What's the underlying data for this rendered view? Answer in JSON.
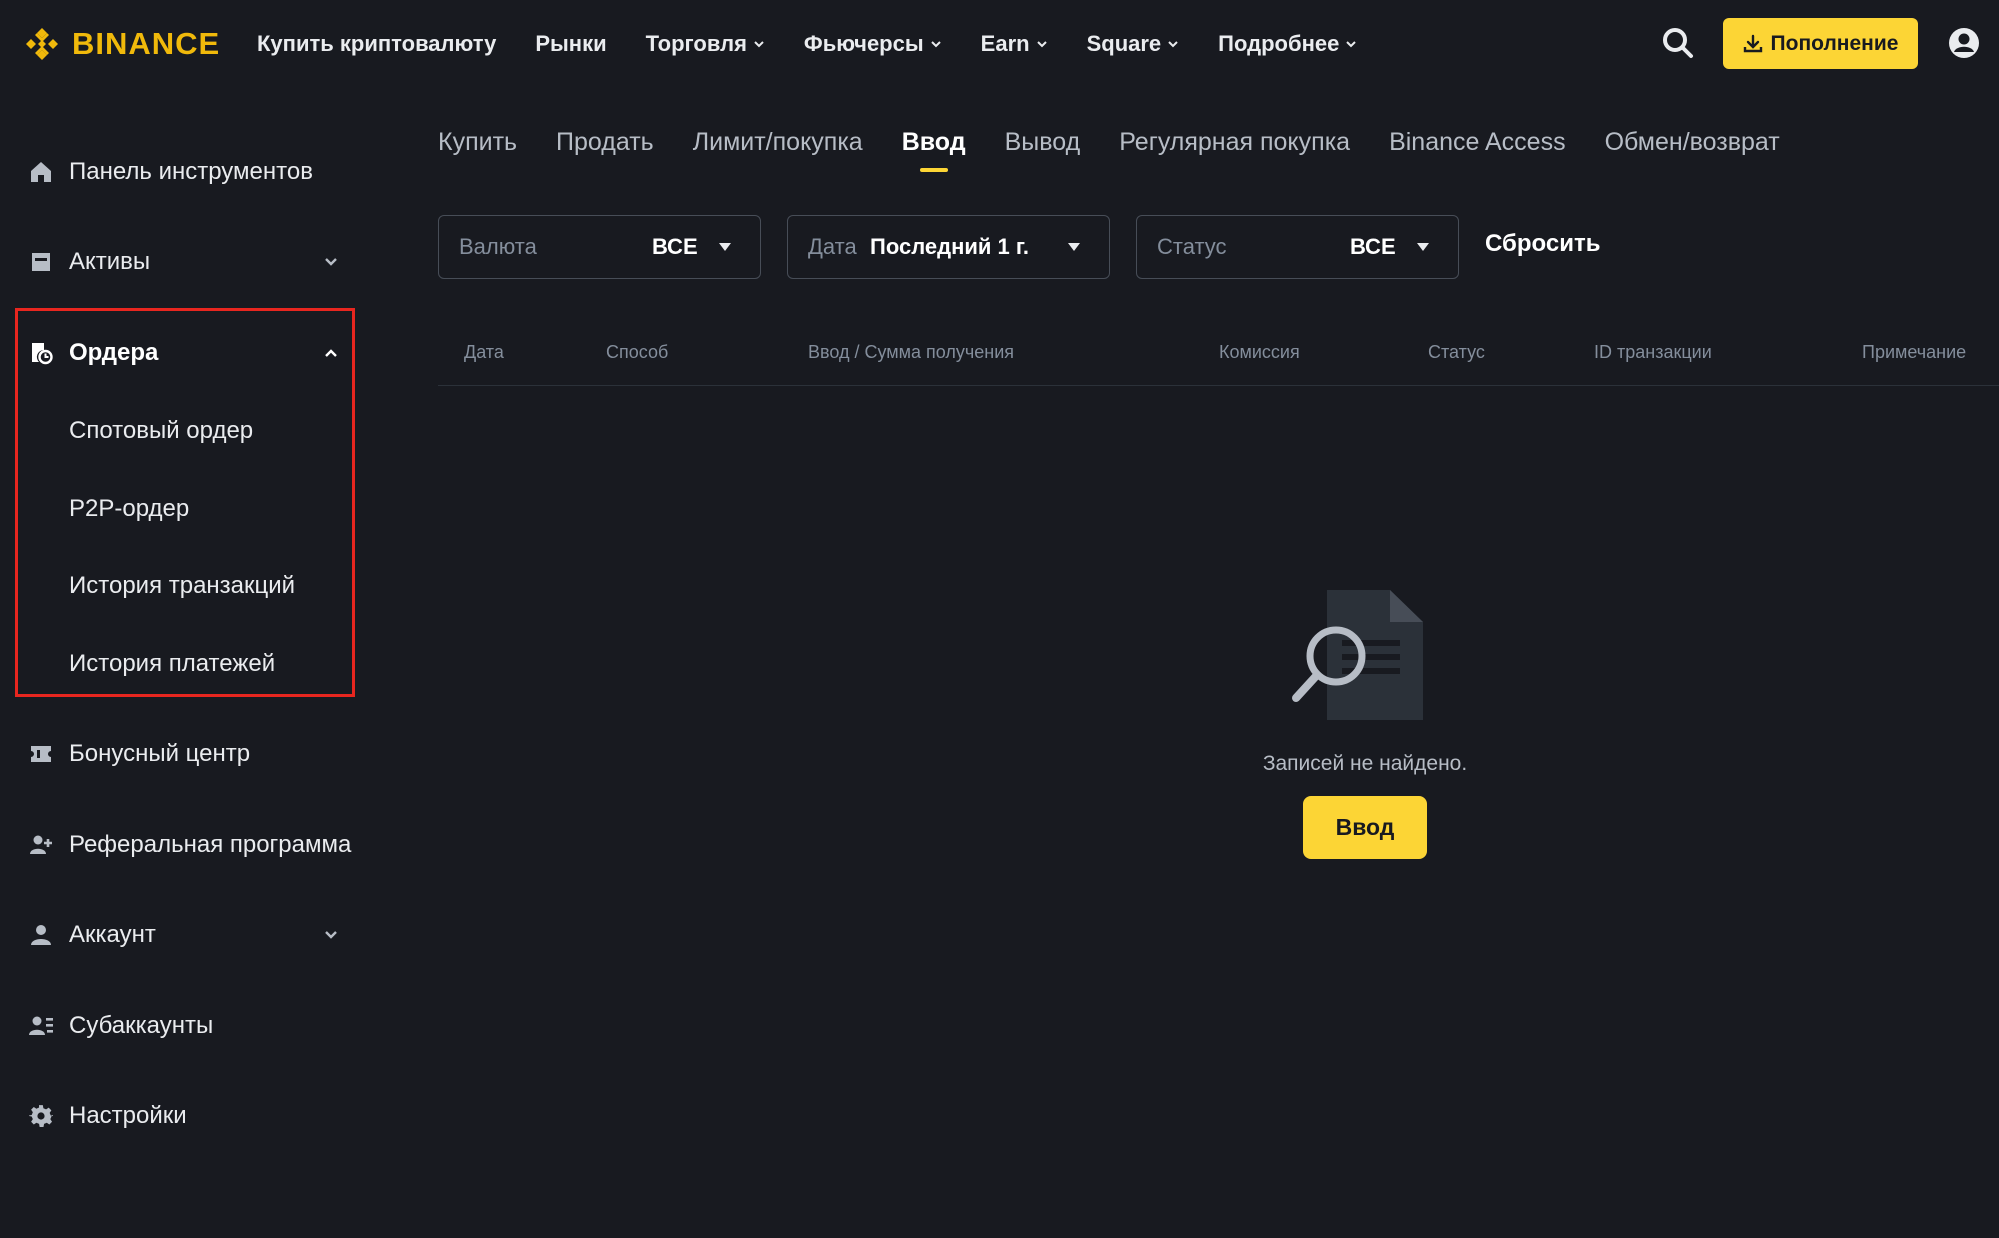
{
  "brand": {
    "name": "BINANCE",
    "color": "#F0B90B"
  },
  "topnav": {
    "items": [
      {
        "label": "Купить криптовалюту",
        "dropdown": false
      },
      {
        "label": "Рынки",
        "dropdown": false
      },
      {
        "label": "Торговля",
        "dropdown": true
      },
      {
        "label": "Фьючерсы",
        "dropdown": true
      },
      {
        "label": "Earn",
        "dropdown": true
      },
      {
        "label": "Square",
        "dropdown": true
      },
      {
        "label": "Подробнее",
        "dropdown": true
      }
    ],
    "deposit_label": "Пополнение",
    "accent": "#FCD535"
  },
  "sidebar": {
    "items": [
      {
        "label": "Панель инструментов",
        "icon": "home-icon"
      },
      {
        "label": "Активы",
        "icon": "wallet-icon"
      },
      {
        "label": "Ордера",
        "icon": "orders-icon"
      },
      {
        "label": "Бонусный центр",
        "icon": "ticket-icon"
      },
      {
        "label": "Реферальная программа",
        "icon": "add-user-icon"
      },
      {
        "label": "Аккаунт",
        "icon": "user-icon"
      },
      {
        "label": "Субаккаунты",
        "icon": "sub-accounts-icon"
      },
      {
        "label": "Настройки",
        "icon": "gear-icon"
      }
    ],
    "orders_sub": [
      {
        "label": "Спотовый ордер"
      },
      {
        "label": "P2P-ордер"
      },
      {
        "label": "История транзакций"
      },
      {
        "label": "История платежей"
      }
    ],
    "highlight_color": "#E8261F"
  },
  "tabs": [
    {
      "label": "Купить"
    },
    {
      "label": "Продать"
    },
    {
      "label": "Лимит/покупка"
    },
    {
      "label": "Ввод",
      "active": true
    },
    {
      "label": "Вывод"
    },
    {
      "label": "Регулярная покупка"
    },
    {
      "label": "Binance Access"
    },
    {
      "label": "Обмен/возврат"
    }
  ],
  "filters": {
    "currency": {
      "label": "Валюта",
      "value": "ВСЕ"
    },
    "date": {
      "label": "Дата",
      "value": "Последний 1 г."
    },
    "status": {
      "label": "Статус",
      "value": "ВСЕ"
    },
    "reset_label": "Сбросить"
  },
  "table": {
    "columns": [
      "Дата",
      "Способ",
      "Ввод / Сумма получения",
      "Комиссия",
      "Статус",
      "ID транзакции",
      "Примечание"
    ]
  },
  "empty": {
    "text": "Записей не найдено.",
    "button_label": "Ввод"
  }
}
